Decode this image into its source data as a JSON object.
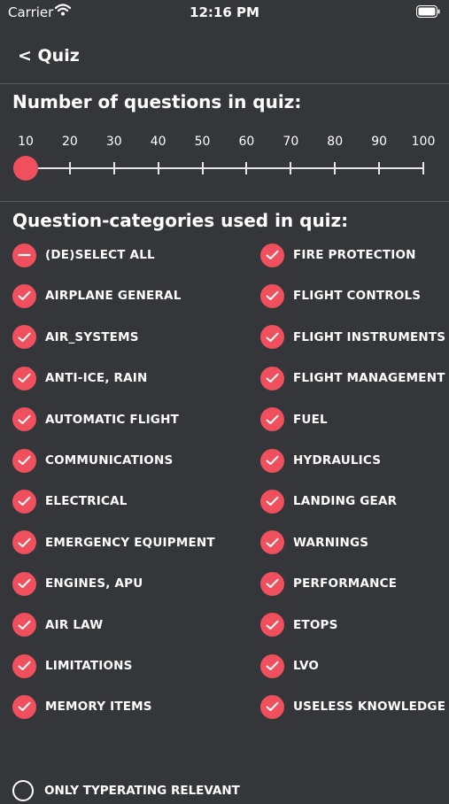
{
  "status_bar": {
    "carrier": "Carrier",
    "time": "12:16 PM"
  },
  "nav": {
    "back_label": "< Quiz"
  },
  "questions_section": {
    "title": "Number of questions in quiz:",
    "ticks": [
      "10",
      "20",
      "30",
      "40",
      "50",
      "60",
      "70",
      "80",
      "90",
      "100"
    ],
    "selected_value": 10
  },
  "categories_section": {
    "title": "Question-categories used in quiz:",
    "left": [
      {
        "label": "(DE)SELECT ALL",
        "state": "deselect"
      },
      {
        "label": "AIRPLANE GENERAL",
        "state": "checked"
      },
      {
        "label": "AIR_SYSTEMS",
        "state": "checked"
      },
      {
        "label": "ANTI-ICE, RAIN",
        "state": "checked"
      },
      {
        "label": "AUTOMATIC FLIGHT",
        "state": "checked"
      },
      {
        "label": "COMMUNICATIONS",
        "state": "checked"
      },
      {
        "label": "ELECTRICAL",
        "state": "checked"
      },
      {
        "label": "EMERGENCY EQUIPMENT",
        "state": "checked"
      },
      {
        "label": "ENGINES, APU",
        "state": "checked"
      },
      {
        "label": "AIR LAW",
        "state": "checked"
      },
      {
        "label": "LIMITATIONS",
        "state": "checked"
      },
      {
        "label": "MEMORY ITEMS",
        "state": "checked"
      }
    ],
    "right": [
      {
        "label": "FIRE PROTECTION",
        "state": "checked"
      },
      {
        "label": "FLIGHT CONTROLS",
        "state": "checked"
      },
      {
        "label": "FLIGHT INSTRUMENTS",
        "state": "checked"
      },
      {
        "label": "FLIGHT MANAGEMENT",
        "state": "checked"
      },
      {
        "label": "FUEL",
        "state": "checked"
      },
      {
        "label": "HYDRAULICS",
        "state": "checked"
      },
      {
        "label": "LANDING GEAR",
        "state": "checked"
      },
      {
        "label": "WARNINGS",
        "state": "checked"
      },
      {
        "label": "PERFORMANCE",
        "state": "checked"
      },
      {
        "label": "ETOPS",
        "state": "checked"
      },
      {
        "label": "LVO",
        "state": "checked"
      },
      {
        "label": "USELESS KNOWLEDGE",
        "state": "checked"
      }
    ]
  },
  "bottom_option": {
    "label": "ONLY TYPERATING RELEVANT"
  },
  "colors": {
    "accent": "#f0505d",
    "background": "#35363a",
    "text": "#ffffff"
  }
}
